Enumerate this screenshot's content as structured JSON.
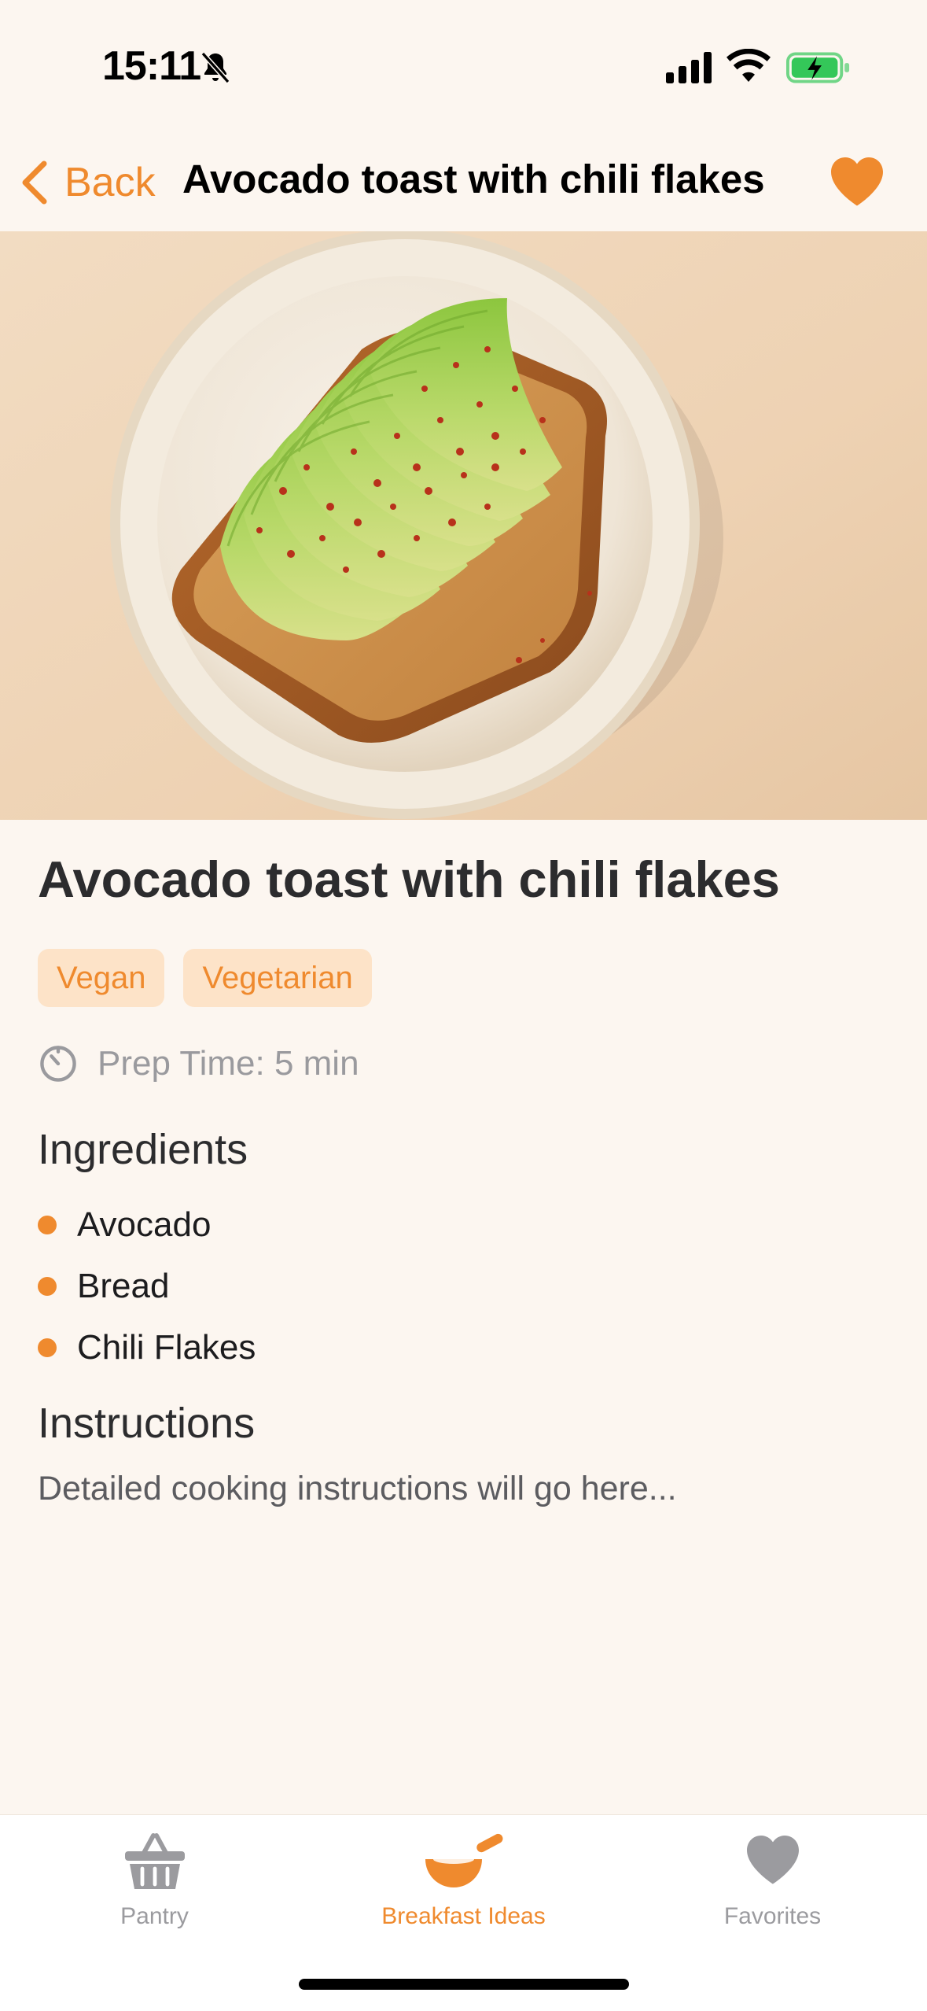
{
  "status_bar": {
    "time": "15:11",
    "icons": [
      "bell-slash-icon",
      "cellular-signal-icon",
      "wifi-icon",
      "battery-charging-icon"
    ]
  },
  "nav": {
    "back_label": "Back",
    "title": "Avocado toast with chili flakes",
    "favorite_icon": "heart-icon"
  },
  "recipe": {
    "title": "Avocado toast with chili flakes",
    "tags": [
      "Vegan",
      "Vegetarian"
    ],
    "prep_time": "Prep Time: 5 min",
    "ingredients_heading": "Ingredients",
    "ingredients": [
      "Avocado",
      "Bread",
      "Chili Flakes"
    ],
    "instructions_heading": "Instructions",
    "instructions": "Detailed cooking instructions will go here..."
  },
  "tab_bar": {
    "tabs": [
      {
        "label": "Pantry",
        "icon": "basket-icon",
        "active": false
      },
      {
        "label": "Breakfast Ideas",
        "icon": "frying-pan-icon",
        "active": true
      },
      {
        "label": "Favorites",
        "icon": "heart-icon",
        "active": false
      }
    ]
  },
  "colors": {
    "accent": "#ef8a2e",
    "background": "#fcf6f0",
    "tag_background": "#fde3c8",
    "inactive_tab": "#9b9b9f"
  }
}
